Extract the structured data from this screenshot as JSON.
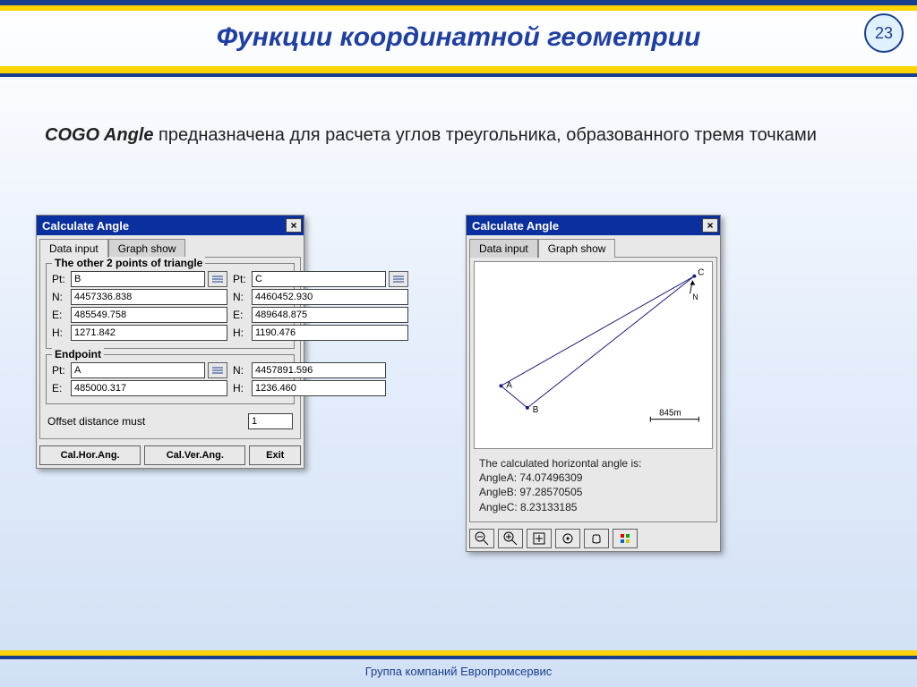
{
  "slide": {
    "title": "Функции координатной геометрии",
    "page": "23",
    "footer": "Группа компаний Европромсервис"
  },
  "desc": {
    "lead": "COGO Angle",
    "rest": " предназначена для расчета углов треугольника, образованного тремя точками"
  },
  "dlg1": {
    "title": "Calculate Angle",
    "tabs": {
      "data": "Data input",
      "graph": "Graph show"
    },
    "group1": "The other 2 points of  triangle",
    "group2": "Endpoint",
    "labels": {
      "pt": "Pt:",
      "n": "N:",
      "e": "E:",
      "h": "H:"
    },
    "ptB": {
      "pt": "B",
      "n": "4457336.838",
      "e": "485549.758",
      "h": "1271.842"
    },
    "ptC": {
      "pt": "C",
      "n": "4460452.930",
      "e": "489648.875",
      "h": "1190.476"
    },
    "end": {
      "pt": "A",
      "n": "4457891.596",
      "e": "485000.317",
      "h": "1236.460"
    },
    "offset_label": "Offset distance must",
    "offset_val": "1",
    "btn_hor": "Cal.Hor.Ang.",
    "btn_ver": "Cal.Ver.Ang.",
    "btn_exit": "Exit"
  },
  "dlg2": {
    "title": "Calculate Angle",
    "tabs": {
      "data": "Data input",
      "graph": "Graph show"
    },
    "scale": "845m",
    "ptA": "A",
    "ptB": "B",
    "ptC": "C",
    "n": "N",
    "result_head": "The calculated horizontal angle is:",
    "angleA": "AngleA: 74.07496309",
    "angleB": "AngleB: 97.28570505",
    "angleC": "AngleC: 8.23133185"
  }
}
